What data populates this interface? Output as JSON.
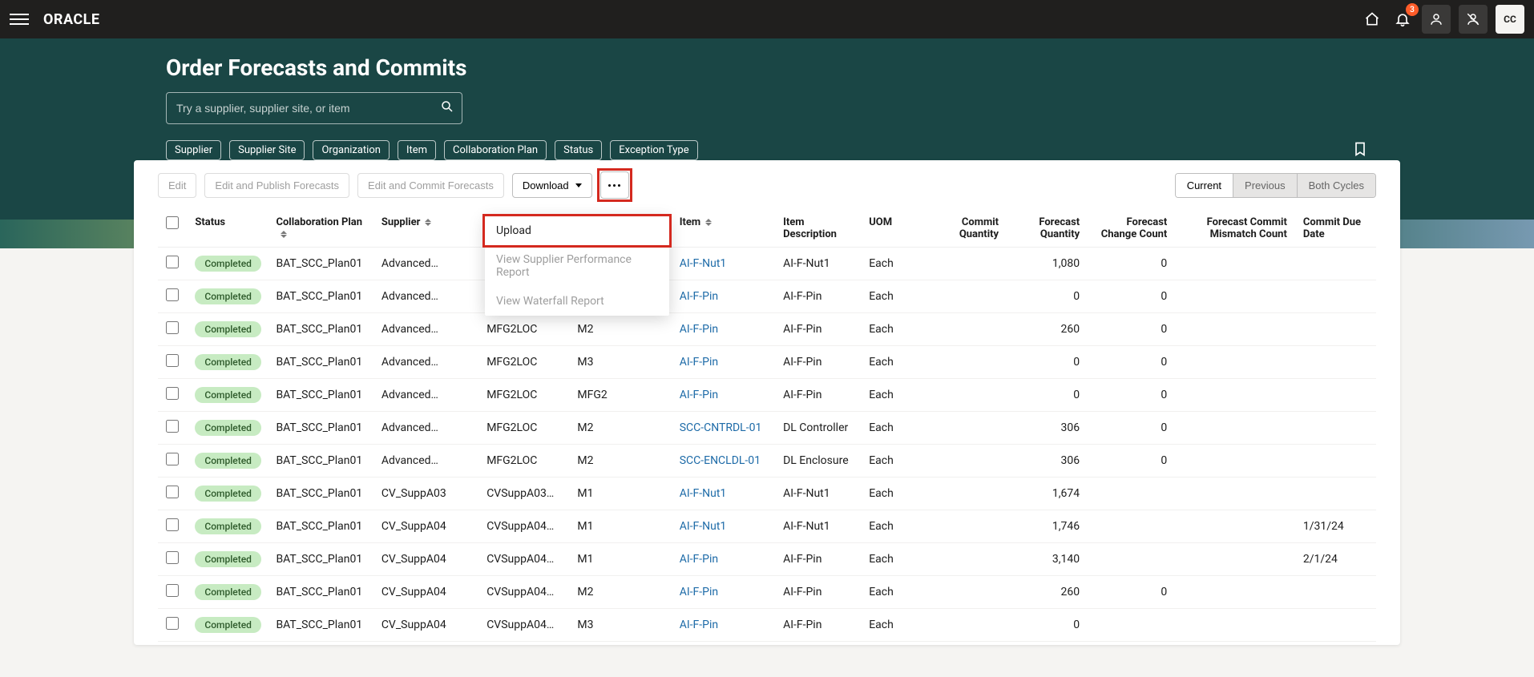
{
  "topbar": {
    "logo": "ORACLE",
    "notif_badge": "3",
    "avatar": "CC"
  },
  "header": {
    "title": "Order Forecasts and Commits",
    "search_placeholder": "Try a supplier, supplier site, or item",
    "chips": [
      "Supplier",
      "Supplier Site",
      "Organization",
      "Item",
      "Collaboration Plan",
      "Status",
      "Exception Type"
    ]
  },
  "toolbar": {
    "edit": "Edit",
    "edit_publish": "Edit and Publish Forecasts",
    "edit_commit": "Edit and Commit Forecasts",
    "download": "Download",
    "segments": {
      "current": "Current",
      "previous": "Previous",
      "both": "Both Cycles"
    }
  },
  "menu": {
    "upload": "Upload",
    "perf": "View Supplier Performance Report",
    "waterfall": "View Waterfall Report"
  },
  "columns": {
    "status": "Status",
    "plan": "Collaboration Plan",
    "supplier": "Supplier",
    "site": "Supplier Site",
    "org": "Organization",
    "item": "Item",
    "desc": "Item Description",
    "uom": "UOM",
    "commitq": "Commit Quantity",
    "forecastq": "Forecast Quantity",
    "fcc": "Forecast Change Count",
    "fcmc": "Forecast Commit Mismatch Count",
    "cdd": "Commit Due Date"
  },
  "rows": [
    {
      "status": "Completed",
      "plan": "BAT_SCC_Plan01",
      "supplier": "Advanced…",
      "site": "",
      "org": "",
      "item": "AI-F-Nut1",
      "desc": "AI-F-Nut1",
      "uom": "Each",
      "commitq": "",
      "forecastq": "1,080",
      "fcc": "0",
      "fcmc": "",
      "cdd": ""
    },
    {
      "status": "Completed",
      "plan": "BAT_SCC_Plan01",
      "supplier": "Advanced…",
      "site": "",
      "org": "",
      "item": "AI-F-Pin",
      "desc": "AI-F-Pin",
      "uom": "Each",
      "commitq": "",
      "forecastq": "0",
      "fcc": "0",
      "fcmc": "",
      "cdd": ""
    },
    {
      "status": "Completed",
      "plan": "BAT_SCC_Plan01",
      "supplier": "Advanced…",
      "site": "MFG2LOC",
      "org": "M2",
      "item": "AI-F-Pin",
      "desc": "AI-F-Pin",
      "uom": "Each",
      "commitq": "",
      "forecastq": "260",
      "fcc": "0",
      "fcmc": "",
      "cdd": ""
    },
    {
      "status": "Completed",
      "plan": "BAT_SCC_Plan01",
      "supplier": "Advanced…",
      "site": "MFG2LOC",
      "org": "M3",
      "item": "AI-F-Pin",
      "desc": "AI-F-Pin",
      "uom": "Each",
      "commitq": "",
      "forecastq": "0",
      "fcc": "0",
      "fcmc": "",
      "cdd": ""
    },
    {
      "status": "Completed",
      "plan": "BAT_SCC_Plan01",
      "supplier": "Advanced…",
      "site": "MFG2LOC",
      "org": "MFG2",
      "item": "AI-F-Pin",
      "desc": "AI-F-Pin",
      "uom": "Each",
      "commitq": "",
      "forecastq": "0",
      "fcc": "0",
      "fcmc": "",
      "cdd": ""
    },
    {
      "status": "Completed",
      "plan": "BAT_SCC_Plan01",
      "supplier": "Advanced…",
      "site": "MFG2LOC",
      "org": "M2",
      "item": "SCC-CNTRDL-01",
      "desc": "DL Controller",
      "uom": "Each",
      "commitq": "",
      "forecastq": "306",
      "fcc": "0",
      "fcmc": "",
      "cdd": ""
    },
    {
      "status": "Completed",
      "plan": "BAT_SCC_Plan01",
      "supplier": "Advanced…",
      "site": "MFG2LOC",
      "org": "M2",
      "item": "SCC-ENCLDL-01",
      "desc": "DL Enclosure",
      "uom": "Each",
      "commitq": "",
      "forecastq": "306",
      "fcc": "0",
      "fcmc": "",
      "cdd": ""
    },
    {
      "status": "Completed",
      "plan": "BAT_SCC_Plan01",
      "supplier": "CV_SuppA03",
      "site": "CVSuppA03…",
      "org": "M1",
      "item": "AI-F-Nut1",
      "desc": "AI-F-Nut1",
      "uom": "Each",
      "commitq": "",
      "forecastq": "1,674",
      "fcc": "",
      "fcmc": "",
      "cdd": ""
    },
    {
      "status": "Completed",
      "plan": "BAT_SCC_Plan01",
      "supplier": "CV_SuppA04",
      "site": "CVSuppA04…",
      "org": "M1",
      "item": "AI-F-Nut1",
      "desc": "AI-F-Nut1",
      "uom": "Each",
      "commitq": "",
      "forecastq": "1,746",
      "fcc": "",
      "fcmc": "",
      "cdd": "1/31/24"
    },
    {
      "status": "Completed",
      "plan": "BAT_SCC_Plan01",
      "supplier": "CV_SuppA04",
      "site": "CVSuppA04…",
      "org": "M1",
      "item": "AI-F-Pin",
      "desc": "AI-F-Pin",
      "uom": "Each",
      "commitq": "",
      "forecastq": "3,140",
      "fcc": "",
      "fcmc": "",
      "cdd": "2/1/24"
    },
    {
      "status": "Completed",
      "plan": "BAT_SCC_Plan01",
      "supplier": "CV_SuppA04",
      "site": "CVSuppA04…",
      "org": "M2",
      "item": "AI-F-Pin",
      "desc": "AI-F-Pin",
      "uom": "Each",
      "commitq": "",
      "forecastq": "260",
      "fcc": "0",
      "fcmc": "",
      "cdd": ""
    },
    {
      "status": "Completed",
      "plan": "BAT_SCC_Plan01",
      "supplier": "CV_SuppA04",
      "site": "CVSuppA04…",
      "org": "M3",
      "item": "AI-F-Pin",
      "desc": "AI-F-Pin",
      "uom": "Each",
      "commitq": "",
      "forecastq": "0",
      "fcc": "",
      "fcmc": "",
      "cdd": ""
    }
  ]
}
